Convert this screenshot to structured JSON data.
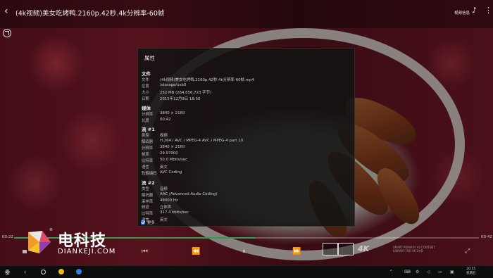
{
  "header": {
    "title": "(4k视频)美女吃烤鸭.2160p.42秒.4k分辨率-60帧",
    "right_text": "视频信息"
  },
  "dialog": {
    "title": "属性",
    "sections": [
      {
        "heading": "文件",
        "rows": [
          {
            "k": "文件",
            "v": "(4k视频)美女吃烤鸭.2160p.42秒.4k分辨率-60帧.mp4"
          },
          {
            "k": "位置",
            "v": "/storage/usb0"
          },
          {
            "k": "大小",
            "v": "252 MB (264,656,723 字节)"
          },
          {
            "k": "日期",
            "v": "2015年12月9日 18:50"
          }
        ]
      },
      {
        "heading": "媒体",
        "rows": [
          {
            "k": "分辨率",
            "v": "3840 × 2160"
          },
          {
            "k": "长度",
            "v": "00:42"
          }
        ]
      },
      {
        "heading": "流 #1",
        "rows": [
          {
            "k": "类型",
            "v": "视频"
          },
          {
            "k": "解码器",
            "v": "H.264 / AVC / MPEG-4 AVC / MPEG-4 part 10"
          },
          {
            "k": "分辨率",
            "v": "3840 × 2160"
          },
          {
            "k": "帧率",
            "v": "29.97000"
          },
          {
            "k": "比特率",
            "v": "50.0 Mbits/sec"
          },
          {
            "k": "语言",
            "v": "英文"
          },
          {
            "k": "软解编码",
            "v": "AVC Coding"
          }
        ]
      },
      {
        "heading": "流 #2",
        "rows": [
          {
            "k": "类型",
            "v": "音频"
          },
          {
            "k": "解码器",
            "v": "AAC (Advanced Audio Coding)"
          },
          {
            "k": "采样率",
            "v": "48000 Hz"
          },
          {
            "k": "频道",
            "v": "立体声"
          },
          {
            "k": "比特率",
            "v": "317.4 kbits/sec"
          },
          {
            "k": "语言",
            "v": "英文"
          }
        ]
      }
    ],
    "more_label": "更多",
    "more_checked": true
  },
  "player": {
    "time_elapsed": "00:22",
    "time_total": "00:42",
    "progress_fraction": 0.52
  },
  "logo": {
    "cn": "电科技",
    "en": "DIANKEJI.COM",
    "mark": "®"
  },
  "watermark": {
    "text": "4K",
    "small": "SMART PRIMARY AV CONTENT LIBRARY FOR 4K UHD"
  },
  "taskbar": {
    "clock_time": "20:55",
    "clock_day": "星期五"
  },
  "colors": {
    "accent": "#2e9e4e",
    "checkbox": "#2a7fe0"
  }
}
